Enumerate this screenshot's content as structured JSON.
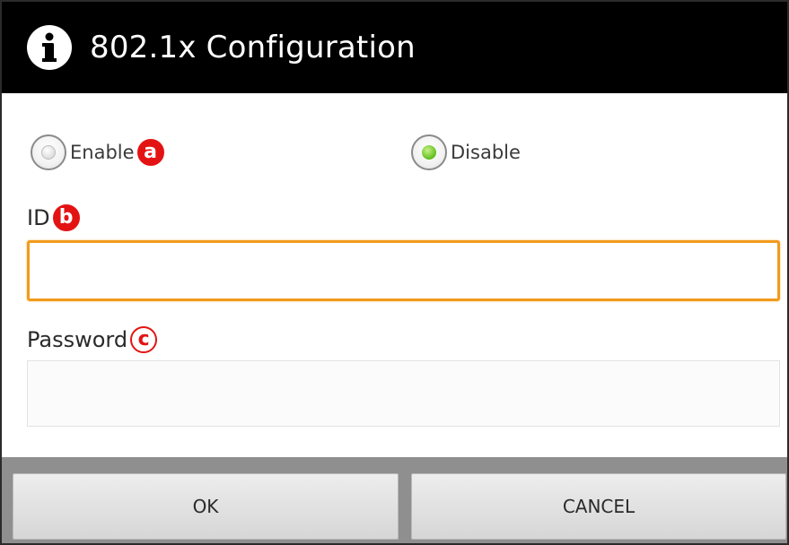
{
  "dialog": {
    "title": "802.1x Configuration",
    "icon": "info-icon"
  },
  "auth_mode": {
    "enable_label": "Enable",
    "disable_label": "Disable",
    "selected": "Disable",
    "marker": "a"
  },
  "id_field": {
    "label": "ID",
    "marker": "b",
    "value": ""
  },
  "password_field": {
    "label": "Password",
    "marker": "c",
    "value": ""
  },
  "buttons": {
    "ok_label": "OK",
    "cancel_label": "CANCEL"
  },
  "colors": {
    "titlebar": "#000000",
    "focus_border": "#f29b1d",
    "selected_radio": "#5fbf1a",
    "marker": "#e41313"
  }
}
